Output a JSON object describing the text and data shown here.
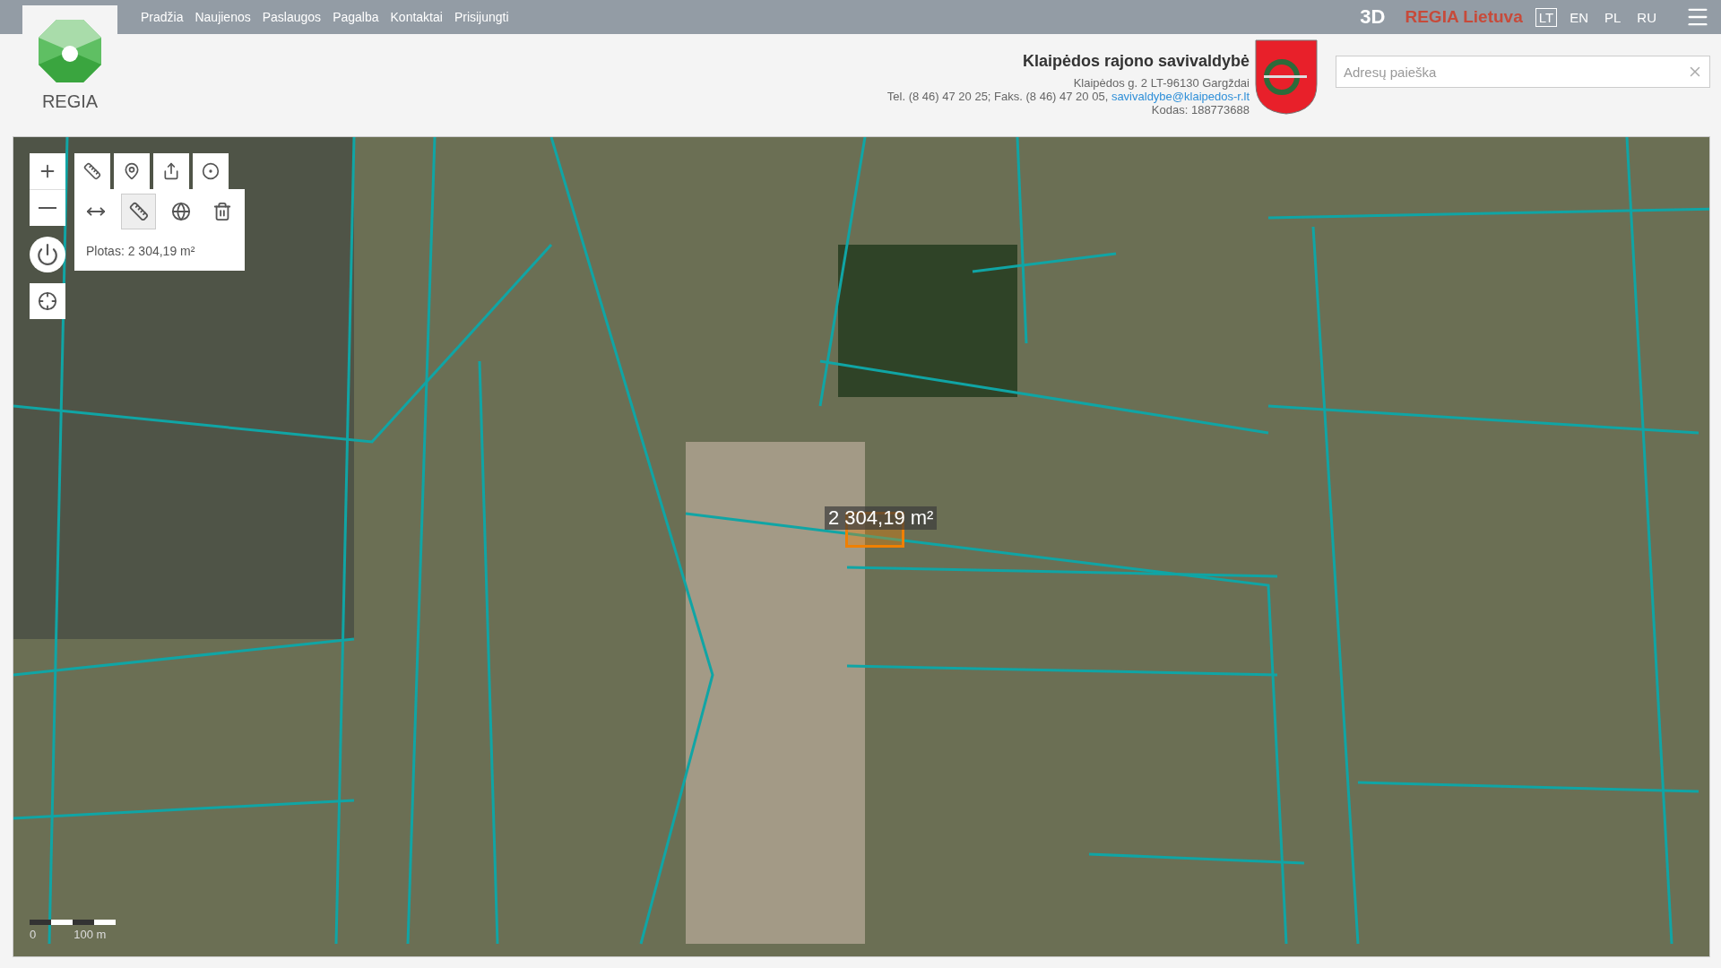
{
  "nav": {
    "items": [
      "Pradžia",
      "Naujienos",
      "Paslaugos",
      "Pagalba",
      "Kontaktai",
      "Prisijungti"
    ],
    "view_3d": "3D",
    "brand": "REGIA Lietuva",
    "languages": [
      {
        "label": "LT",
        "selected": true
      },
      {
        "label": "EN",
        "selected": false
      },
      {
        "label": "PL",
        "selected": false
      },
      {
        "label": "RU",
        "selected": false
      }
    ]
  },
  "logo": {
    "text": "REGIA"
  },
  "municipality": {
    "name": "Klaipėdos rajono savivaldybė",
    "address": "Klaipėdos g. 2 LT-96130 Gargždai",
    "phones": "Tel. (8 46) 47 20 25; Faks. (8 46) 47 20 05, ",
    "email": "savivaldybe@klaipedos-r.lt",
    "code": "Kodas: 188773688"
  },
  "search": {
    "placeholder": "Adresų paieška"
  },
  "tools": {
    "top": [
      {
        "kind": "ruler",
        "selected": false
      },
      {
        "kind": "pin",
        "selected": false
      },
      {
        "kind": "share",
        "selected": false
      },
      {
        "kind": "target",
        "selected": false
      }
    ],
    "measure": [
      {
        "kind": "distance",
        "selected": false
      },
      {
        "kind": "area",
        "selected": true
      },
      {
        "kind": "globe",
        "selected": false
      },
      {
        "kind": "trash",
        "selected": false
      }
    ],
    "result": "Plotas: 2 304,19 m²"
  },
  "map": {
    "measurement": "2 304,19 m²",
    "scale_zero": "0",
    "scale_label": "100 m"
  }
}
